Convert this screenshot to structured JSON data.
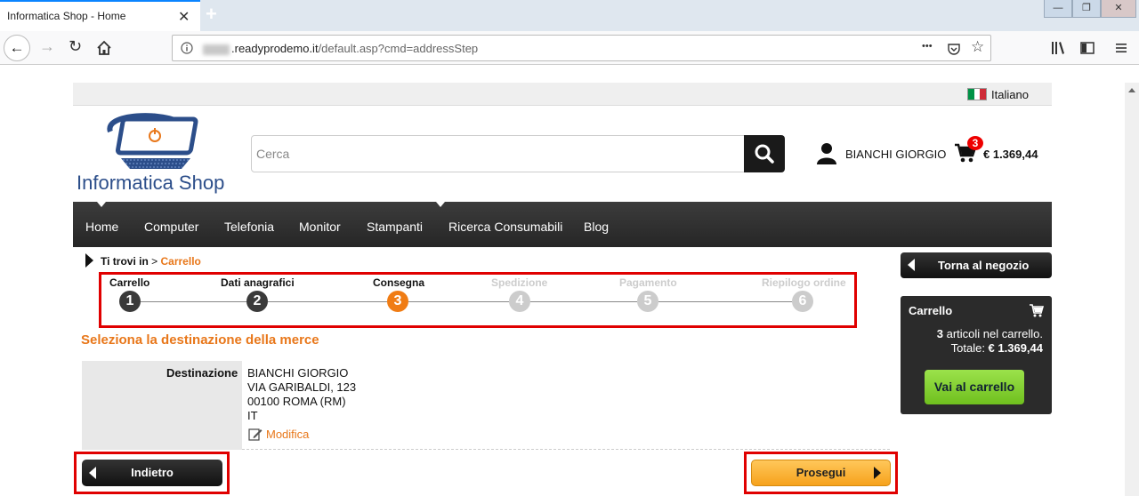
{
  "browser": {
    "tab_title": "Informatica Shop - Home",
    "tab_close": "✕",
    "new_tab": "+",
    "url_domain": ".readyprodemo.it",
    "url_path": "/default.asp?cmd=addressStep",
    "win_min": "—",
    "win_max": "❐",
    "win_close": "✕",
    "more_dots": "•••"
  },
  "header": {
    "language": "Italiano",
    "logo_text": "Informatica Shop",
    "search_placeholder": "Cerca",
    "user_name": "BIANCHI GIORGIO",
    "cart_count": "3",
    "cart_total": "€ 1.369,44"
  },
  "menu": {
    "items": [
      "Home",
      "Computer",
      "Telefonia",
      "Monitor",
      "Stampanti",
      "Ricerca Consumabili",
      "Blog"
    ]
  },
  "breadcrumb": {
    "label": "Ti trovi in",
    "separator": ">",
    "current": "Carrello"
  },
  "steps": {
    "items": [
      {
        "label": "Carrello",
        "number": "1",
        "state": "done"
      },
      {
        "label": "Dati anagrafici",
        "number": "2",
        "state": "done"
      },
      {
        "label": "Consegna",
        "number": "3",
        "state": "active"
      },
      {
        "label": "Spedizione",
        "number": "4",
        "state": "pending"
      },
      {
        "label": "Pagamento",
        "number": "5",
        "state": "pending"
      },
      {
        "label": "Riepilogo ordine",
        "number": "6",
        "state": "pending"
      }
    ]
  },
  "main": {
    "section_title": "Seleziona la destinazione della merce",
    "dest_label": "Destinazione",
    "address": [
      "BIANCHI GIORGIO",
      "VIA GARIBALDI, 123",
      "00100 ROMA (RM)",
      "IT"
    ],
    "edit_link": "Modifica",
    "back_button": "Indietro",
    "next_button": "Prosegui"
  },
  "sidebar": {
    "back_shop": "Torna al negozio",
    "cart_title": "Carrello",
    "cart_count": "3",
    "cart_count_text": " articoli nel carrello.",
    "cart_total_label": "Totale: ",
    "cart_total": "€ 1.369,44",
    "cart_button": "Vai al carrello"
  },
  "colors": {
    "accent_orange": "#e8771a",
    "step_done": "#3a3a3a",
    "step_active": "#f07c14",
    "step_pending": "#cccccc",
    "highlight_red": "#e00000",
    "cart_button_green": "#7dcc2a"
  }
}
